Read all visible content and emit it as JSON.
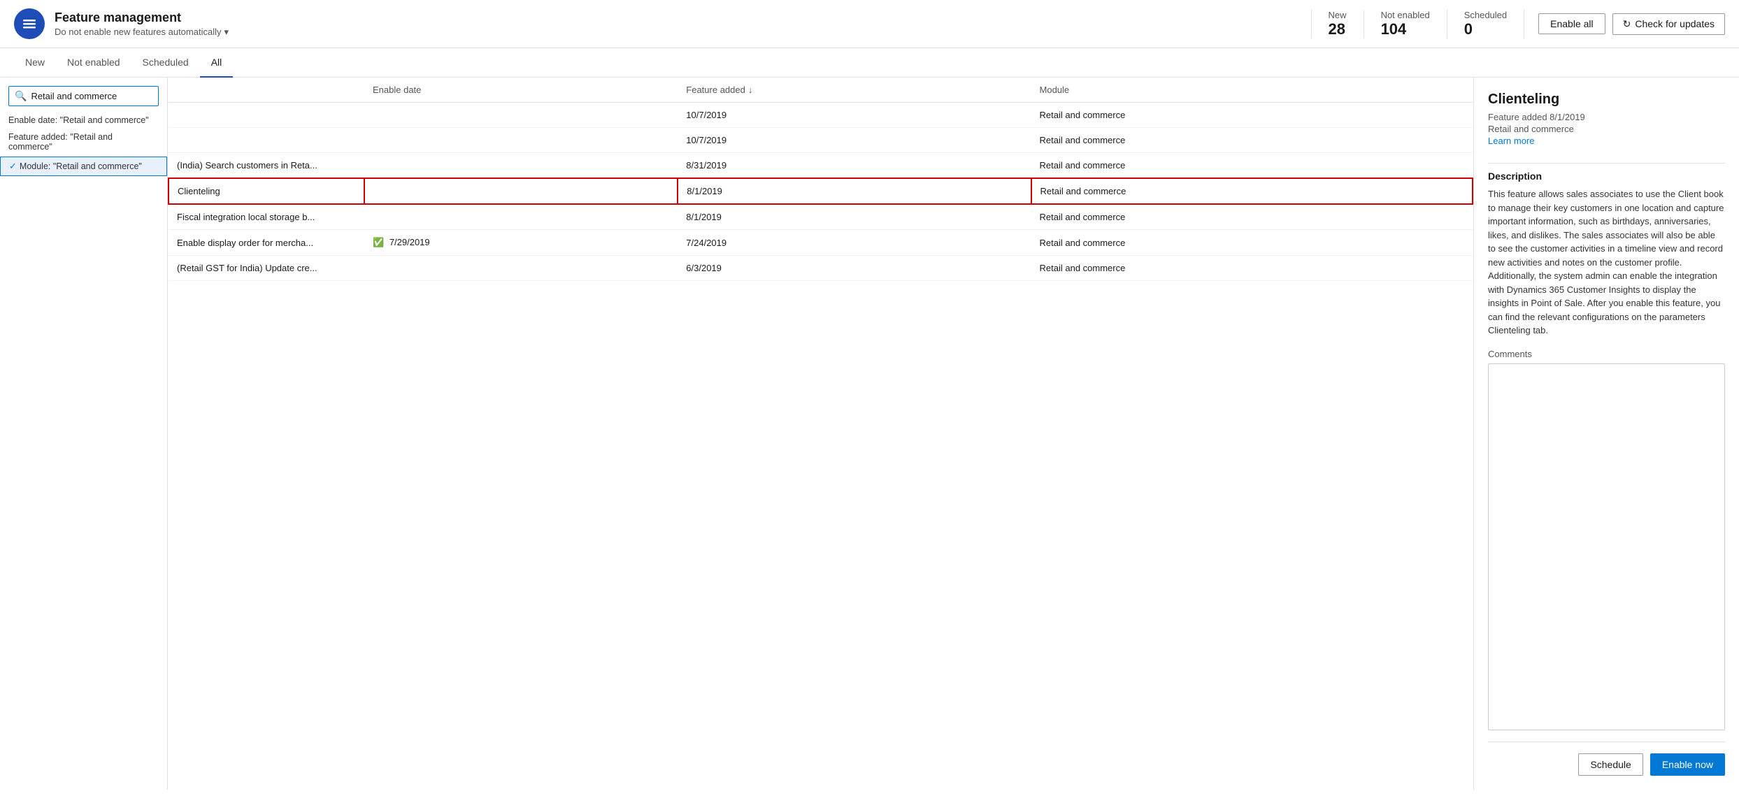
{
  "header": {
    "title": "Feature management",
    "subtitle": "Do not enable new features automatically",
    "subtitle_arrow": "▾",
    "stats": [
      {
        "label": "New",
        "value": "28"
      },
      {
        "label": "Not enabled",
        "value": "104"
      },
      {
        "label": "Scheduled",
        "value": "0"
      }
    ],
    "enable_all_label": "Enable all",
    "check_updates_label": "Check for updates"
  },
  "tabs": [
    {
      "label": "New",
      "active": false
    },
    {
      "label": "Not enabled",
      "active": false
    },
    {
      "label": "Scheduled",
      "active": false
    },
    {
      "label": "All",
      "active": true
    }
  ],
  "search": {
    "value": "Retail and commerce",
    "placeholder": "Search"
  },
  "suggestions": [
    {
      "text": "Enable date: \"Retail and commerce\""
    },
    {
      "text": "Feature added: \"Retail and commerce\""
    }
  ],
  "selected_suggestion": "Module: \"Retail and commerce\"",
  "table": {
    "columns": [
      {
        "label": "Enable date"
      },
      {
        "label": "Feature added",
        "sort": "↓"
      },
      {
        "label": "Module"
      }
    ],
    "rows": [
      {
        "name": "",
        "enable_date": "",
        "feature_added": "10/7/2019",
        "module": "Retail and commerce",
        "selected": false,
        "has_check": false
      },
      {
        "name": "",
        "enable_date": "",
        "feature_added": "10/7/2019",
        "module": "Retail and commerce",
        "selected": false,
        "has_check": false
      },
      {
        "name": "(India) Search customers in Reta...",
        "enable_date": "",
        "feature_added": "8/31/2019",
        "module": "Retail and commerce",
        "selected": false,
        "has_check": false
      },
      {
        "name": "Clienteling",
        "enable_date": "",
        "feature_added": "8/1/2019",
        "module": "Retail and commerce",
        "selected": true,
        "has_check": false
      },
      {
        "name": "Fiscal integration local storage b...",
        "enable_date": "",
        "feature_added": "8/1/2019",
        "module": "Retail and commerce",
        "selected": false,
        "has_check": false
      },
      {
        "name": "Enable display order for mercha...",
        "enable_date": "7/29/2019",
        "feature_added": "7/24/2019",
        "module": "Retail and commerce",
        "selected": false,
        "has_check": true
      },
      {
        "name": "(Retail GST for India) Update cre...",
        "enable_date": "",
        "feature_added": "6/3/2019",
        "module": "Retail and commerce",
        "selected": false,
        "has_check": false
      }
    ]
  },
  "detail": {
    "title": "Clienteling",
    "feature_added": "Feature added 8/1/2019",
    "module": "Retail and commerce",
    "learn_more": "Learn more",
    "description_title": "Description",
    "description": "This feature allows sales associates to use the Client book to manage their key customers in one location and capture important information, such as birthdays, anniversaries, likes, and dislikes. The sales associates will also be able to see the customer activities in a timeline view and record new activities and notes on the customer profile. Additionally, the system admin can enable the integration with Dynamics 365 Customer Insights to display the insights in Point of Sale. After you enable this feature, you can find the relevant configurations on the parameters Clienteling tab.",
    "comments_label": "Comments",
    "schedule_label": "Schedule",
    "enable_now_label": "Enable now"
  }
}
